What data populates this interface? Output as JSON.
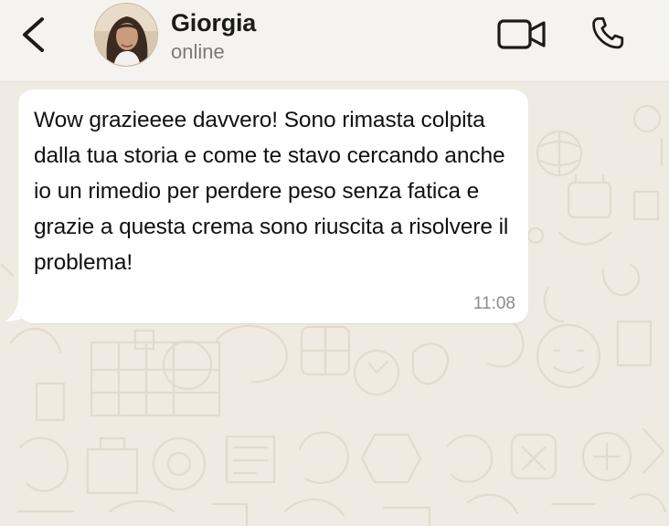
{
  "header": {
    "contact_name": "Giorgia",
    "contact_status": "online",
    "icons": {
      "back": "chevron-left-icon",
      "video": "video-camera-icon",
      "call": "phone-icon"
    }
  },
  "messages": [
    {
      "direction": "incoming",
      "text": "Wow grazieeee davvero! Sono rimasta colpita dalla tua storia e come te stavo cercando anche io un rimedio per perdere peso senza fatica e grazie a questa crema sono riuscita a risolvere il problema!",
      "time": "11:08"
    }
  ],
  "colors": {
    "header_bg": "#f5f3ef",
    "chat_bg": "#efeae2",
    "bubble_bg": "#ffffff",
    "doodle": "#e3dccf"
  }
}
